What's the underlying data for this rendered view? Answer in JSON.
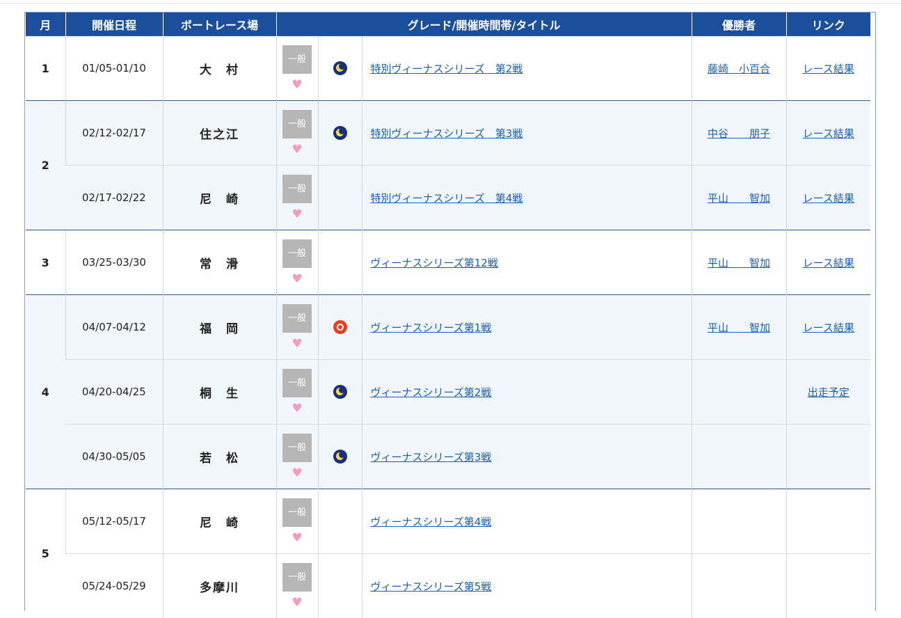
{
  "header": {
    "month": "月",
    "dates": "開催日程",
    "venue": "ボートレース場",
    "grade_title": "グレード/開催時間帯/タイトル",
    "winner": "優勝者",
    "link": "リンク"
  },
  "grade_label": "一般",
  "heart_icon": "heart-icon",
  "time_icons": {
    "night": "nighter-moon-icon",
    "day": "morning-sun-icon"
  },
  "months": [
    {
      "month": "1",
      "races": [
        {
          "dates": "01/05-01/10",
          "venue": "大　村",
          "time": "night",
          "title": "特別ヴィーナスシリーズ　第2戦",
          "winner": "藤崎　小百合",
          "link": "レース結果"
        }
      ]
    },
    {
      "month": "2",
      "races": [
        {
          "dates": "02/12-02/17",
          "venue": "住之江",
          "time": "night",
          "title": "特別ヴィーナスシリーズ　第3戦",
          "winner": "中谷　　朋子",
          "link": "レース結果"
        },
        {
          "dates": "02/17-02/22",
          "venue": "尼　崎",
          "time": "",
          "title": "特別ヴィーナスシリーズ　第4戦",
          "winner": "平山　　智加",
          "link": "レース結果"
        }
      ]
    },
    {
      "month": "3",
      "races": [
        {
          "dates": "03/25-03/30",
          "venue": "常　滑",
          "time": "",
          "title": "ヴィーナスシリーズ第12戦",
          "winner": "平山　　智加",
          "link": "レース結果"
        }
      ]
    },
    {
      "month": "4",
      "races": [
        {
          "dates": "04/07-04/12",
          "venue": "福　岡",
          "time": "day",
          "title": "ヴィーナスシリーズ第1戦",
          "winner": "平山　　智加",
          "link": "レース結果"
        },
        {
          "dates": "04/20-04/25",
          "venue": "桐　生",
          "time": "night",
          "title": "ヴィーナスシリーズ第2戦",
          "winner": "",
          "link": "出走予定"
        },
        {
          "dates": "04/30-05/05",
          "venue": "若　松",
          "time": "night",
          "title": "ヴィーナスシリーズ第3戦",
          "winner": "",
          "link": ""
        }
      ]
    },
    {
      "month": "5",
      "races": [
        {
          "dates": "05/12-05/17",
          "venue": "尼　崎",
          "time": "",
          "title": "ヴィーナスシリーズ第4戦",
          "winner": "",
          "link": ""
        },
        {
          "dates": "05/24-05/29",
          "venue": "多摩川",
          "time": "",
          "title": "ヴィーナスシリーズ第5戦",
          "winner": "",
          "link": ""
        }
      ]
    }
  ]
}
